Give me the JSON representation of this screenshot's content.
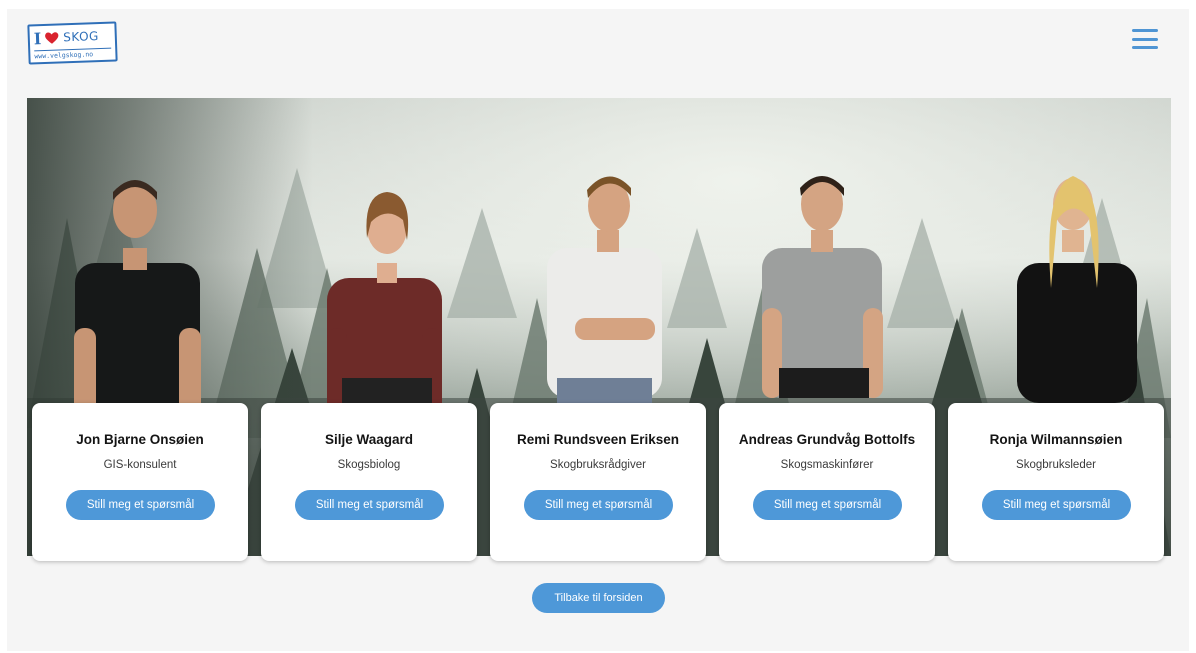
{
  "header": {
    "logo": {
      "word_i": "I",
      "word_skog": "SKOG",
      "url": "www.velgskog.no"
    },
    "menu_icon": "hamburger-menu-icon"
  },
  "hero": {
    "background": "foggy-spruce-forest"
  },
  "team": [
    {
      "name": "Jon Bjarne Onsøien",
      "role": "GIS-konsulent",
      "button": "Still meg et spørsmål"
    },
    {
      "name": "Silje Waagard",
      "role": "Skogsbiolog",
      "button": "Still meg et spørsmål"
    },
    {
      "name": "Remi Rundsveen Eriksen",
      "role": "Skogbruksrådgiver",
      "button": "Still meg et spørsmål"
    },
    {
      "name": "Andreas Grundvåg Bottolfs",
      "role": "Skogsmaskinfører",
      "button": "Still meg et spørsmål"
    },
    {
      "name": "Ronja Wilmannsøien",
      "role": "Skogbruksleder",
      "button": "Still meg et spørsmål"
    }
  ],
  "footer": {
    "back_label": "Tilbake til forsiden"
  },
  "colors": {
    "accent": "#4e98d8",
    "logo_blue": "#2f6fb8",
    "heart": "#d9232e",
    "page_background": "#f5f5f5"
  }
}
